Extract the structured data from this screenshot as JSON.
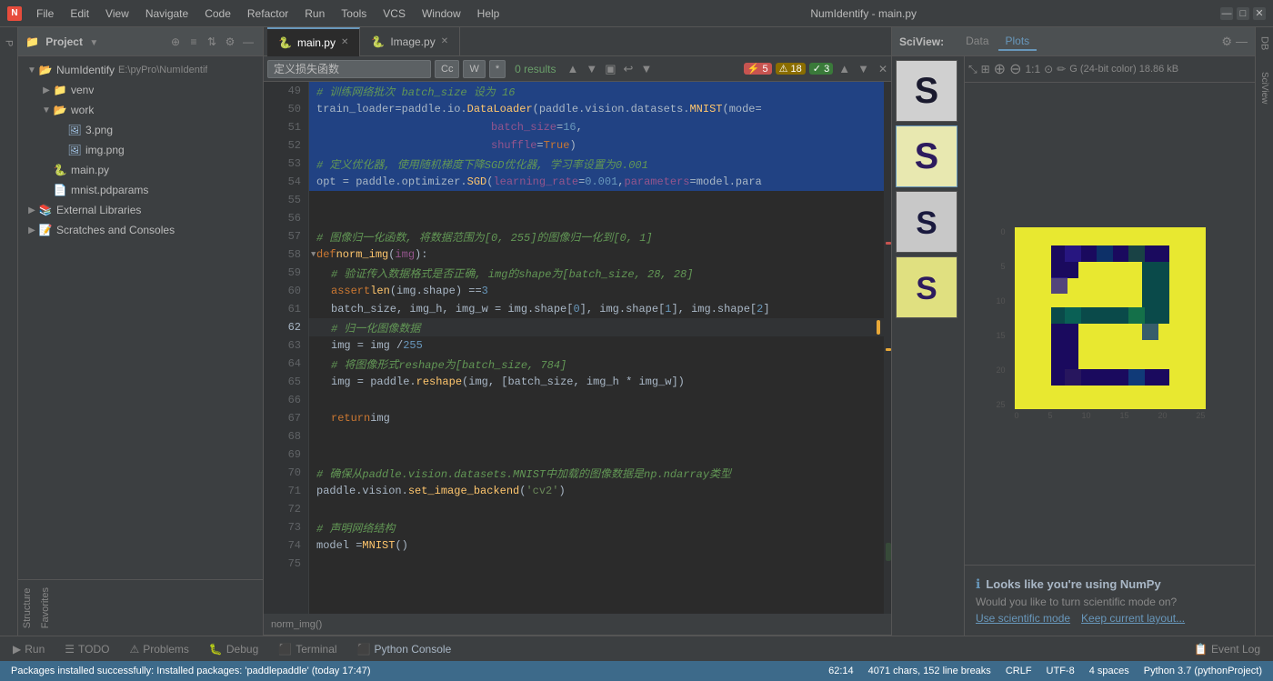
{
  "titlebar": {
    "logo": "N",
    "project": "NumIdentify",
    "file": "main.py",
    "title": "NumIdentify - main.py",
    "menus": [
      "File",
      "Edit",
      "View",
      "Navigate",
      "Code",
      "Refactor",
      "Run",
      "Tools",
      "VCS",
      "Window",
      "Help"
    ]
  },
  "tabs": [
    {
      "label": "main.py",
      "active": true
    },
    {
      "label": "Image.py",
      "active": false
    }
  ],
  "search": {
    "placeholder": "定义损失函数",
    "result": "0 results",
    "warnings": {
      "errors": 5,
      "warnings": 18,
      "hints": 3
    },
    "buttons": [
      "Cc",
      "W",
      "*"
    ]
  },
  "code_lines": [
    {
      "num": 49,
      "content": "# 训练网络批次 batch_size 设为 16",
      "type": "comment",
      "highlighted": true
    },
    {
      "num": 50,
      "content": "train_loader = paddle.io.DataLoader(paddle.vision.datasets.MNIST(mode=",
      "type": "code",
      "highlighted": true
    },
    {
      "num": 51,
      "content": "                                    batch_size=16,",
      "type": "code",
      "highlighted": true
    },
    {
      "num": 52,
      "content": "                                    shuffle=True)",
      "type": "code",
      "highlighted": true
    },
    {
      "num": 53,
      "content": "# 定义优化器, 使用随机梯度下降SGD优化器, 学习率设置为0.001",
      "type": "comment",
      "highlighted": true
    },
    {
      "num": 54,
      "content": "opt = paddle.optimizer.SGD(learning_rate=0.001, parameters=model.param",
      "type": "code",
      "highlighted": true
    },
    {
      "num": 55,
      "content": "",
      "type": "empty",
      "highlighted": false
    },
    {
      "num": 56,
      "content": "",
      "type": "empty",
      "highlighted": false
    },
    {
      "num": 57,
      "content": "# 图像归一化函数, 将数据范围为[0, 255]的图像归一化到[0, 1]",
      "type": "comment",
      "highlighted": false
    },
    {
      "num": 58,
      "content": "def norm_img(img):",
      "type": "code",
      "highlighted": false
    },
    {
      "num": 59,
      "content": "    # 验证传入数据格式是否正确, img的shape为[batch_size, 28, 28]",
      "type": "comment",
      "highlighted": false
    },
    {
      "num": 60,
      "content": "    assert len(img.shape) == 3",
      "type": "code",
      "highlighted": false
    },
    {
      "num": 61,
      "content": "    batch_size, img_h, img_w = img.shape[0], img.shape[1], img.shape[2]",
      "type": "code",
      "highlighted": false
    },
    {
      "num": 62,
      "content": "    # 归一化图像数据",
      "type": "comment",
      "highlighted": false,
      "bookmark": true
    },
    {
      "num": 63,
      "content": "    img = img / 255",
      "type": "code",
      "highlighted": false
    },
    {
      "num": 64,
      "content": "    # 将图像形式reshape为[batch_size, 784]",
      "type": "comment",
      "highlighted": false
    },
    {
      "num": 65,
      "content": "    img = paddle.reshape(img, [batch_size, img_h * img_w])",
      "type": "code",
      "highlighted": false
    },
    {
      "num": 66,
      "content": "",
      "type": "empty",
      "highlighted": false
    },
    {
      "num": 67,
      "content": "    return img",
      "type": "code",
      "highlighted": false
    },
    {
      "num": 68,
      "content": "",
      "type": "empty",
      "highlighted": false
    },
    {
      "num": 69,
      "content": "",
      "type": "empty",
      "highlighted": false
    },
    {
      "num": 70,
      "content": "# 确保从paddle.vision.datasets.MNIST中加载的图像数据是np.ndarray类型",
      "type": "comment",
      "highlighted": false
    },
    {
      "num": 71,
      "content": "paddle.vision.set_image_backend('cv2')",
      "type": "code",
      "highlighted": false
    },
    {
      "num": 72,
      "content": "",
      "type": "empty",
      "highlighted": false
    },
    {
      "num": 73,
      "content": "# 声明网络结构",
      "type": "comment",
      "highlighted": false
    },
    {
      "num": 74,
      "content": "model = MNIST()",
      "type": "code",
      "highlighted": false
    },
    {
      "num": 75,
      "content": "",
      "type": "empty",
      "highlighted": false
    }
  ],
  "breadcrumb": "norm_img()",
  "sciview": {
    "title": "SciView:",
    "tabs": [
      "Data",
      "Plots"
    ],
    "active_tab": "Plots",
    "info_text": "G (24-bit color)  18.86 kB"
  },
  "sidebar": {
    "title": "Project",
    "tree": [
      {
        "label": "NumIdentify",
        "path": "E:\\pyPro\\NumIdentif",
        "level": 0,
        "type": "project",
        "expanded": true
      },
      {
        "label": "venv",
        "level": 1,
        "type": "folder",
        "expanded": false
      },
      {
        "label": "work",
        "level": 1,
        "type": "folder",
        "expanded": true
      },
      {
        "label": "3.png",
        "level": 2,
        "type": "image"
      },
      {
        "label": "img.png",
        "level": 2,
        "type": "image"
      },
      {
        "label": "main.py",
        "level": 1,
        "type": "python"
      },
      {
        "label": "mnist.pdparams",
        "level": 1,
        "type": "file"
      },
      {
        "label": "External Libraries",
        "level": 0,
        "type": "lib",
        "expanded": false
      },
      {
        "label": "Scratches and Consoles",
        "level": 0,
        "type": "scratches"
      }
    ]
  },
  "bottom_tabs": [
    {
      "label": "Run",
      "icon": "▶"
    },
    {
      "label": "TODO",
      "icon": "☰"
    },
    {
      "label": "Problems",
      "icon": "⚠"
    },
    {
      "label": "Debug",
      "icon": "🐛"
    },
    {
      "label": "Terminal",
      "icon": "⬛"
    },
    {
      "label": "Python Console",
      "icon": "⬛",
      "active": true
    }
  ],
  "status_bar": {
    "message": "Packages installed successfully: Installed packages: 'paddlepaddle' (today 17:47)",
    "position": "62:14",
    "chars": "4071 chars, 152 line breaks",
    "line_ending": "CRLF",
    "encoding": "UTF-8",
    "indent": "4 spaces",
    "python": "Python 3.7 (pythonProject)",
    "event_log": "Event Log"
  },
  "numpy_popup": {
    "title": "Looks like you're using NumPy",
    "text": "Would you like to turn scientific mode on?",
    "links": [
      "Use scientific mode",
      "Keep current layout..."
    ]
  }
}
